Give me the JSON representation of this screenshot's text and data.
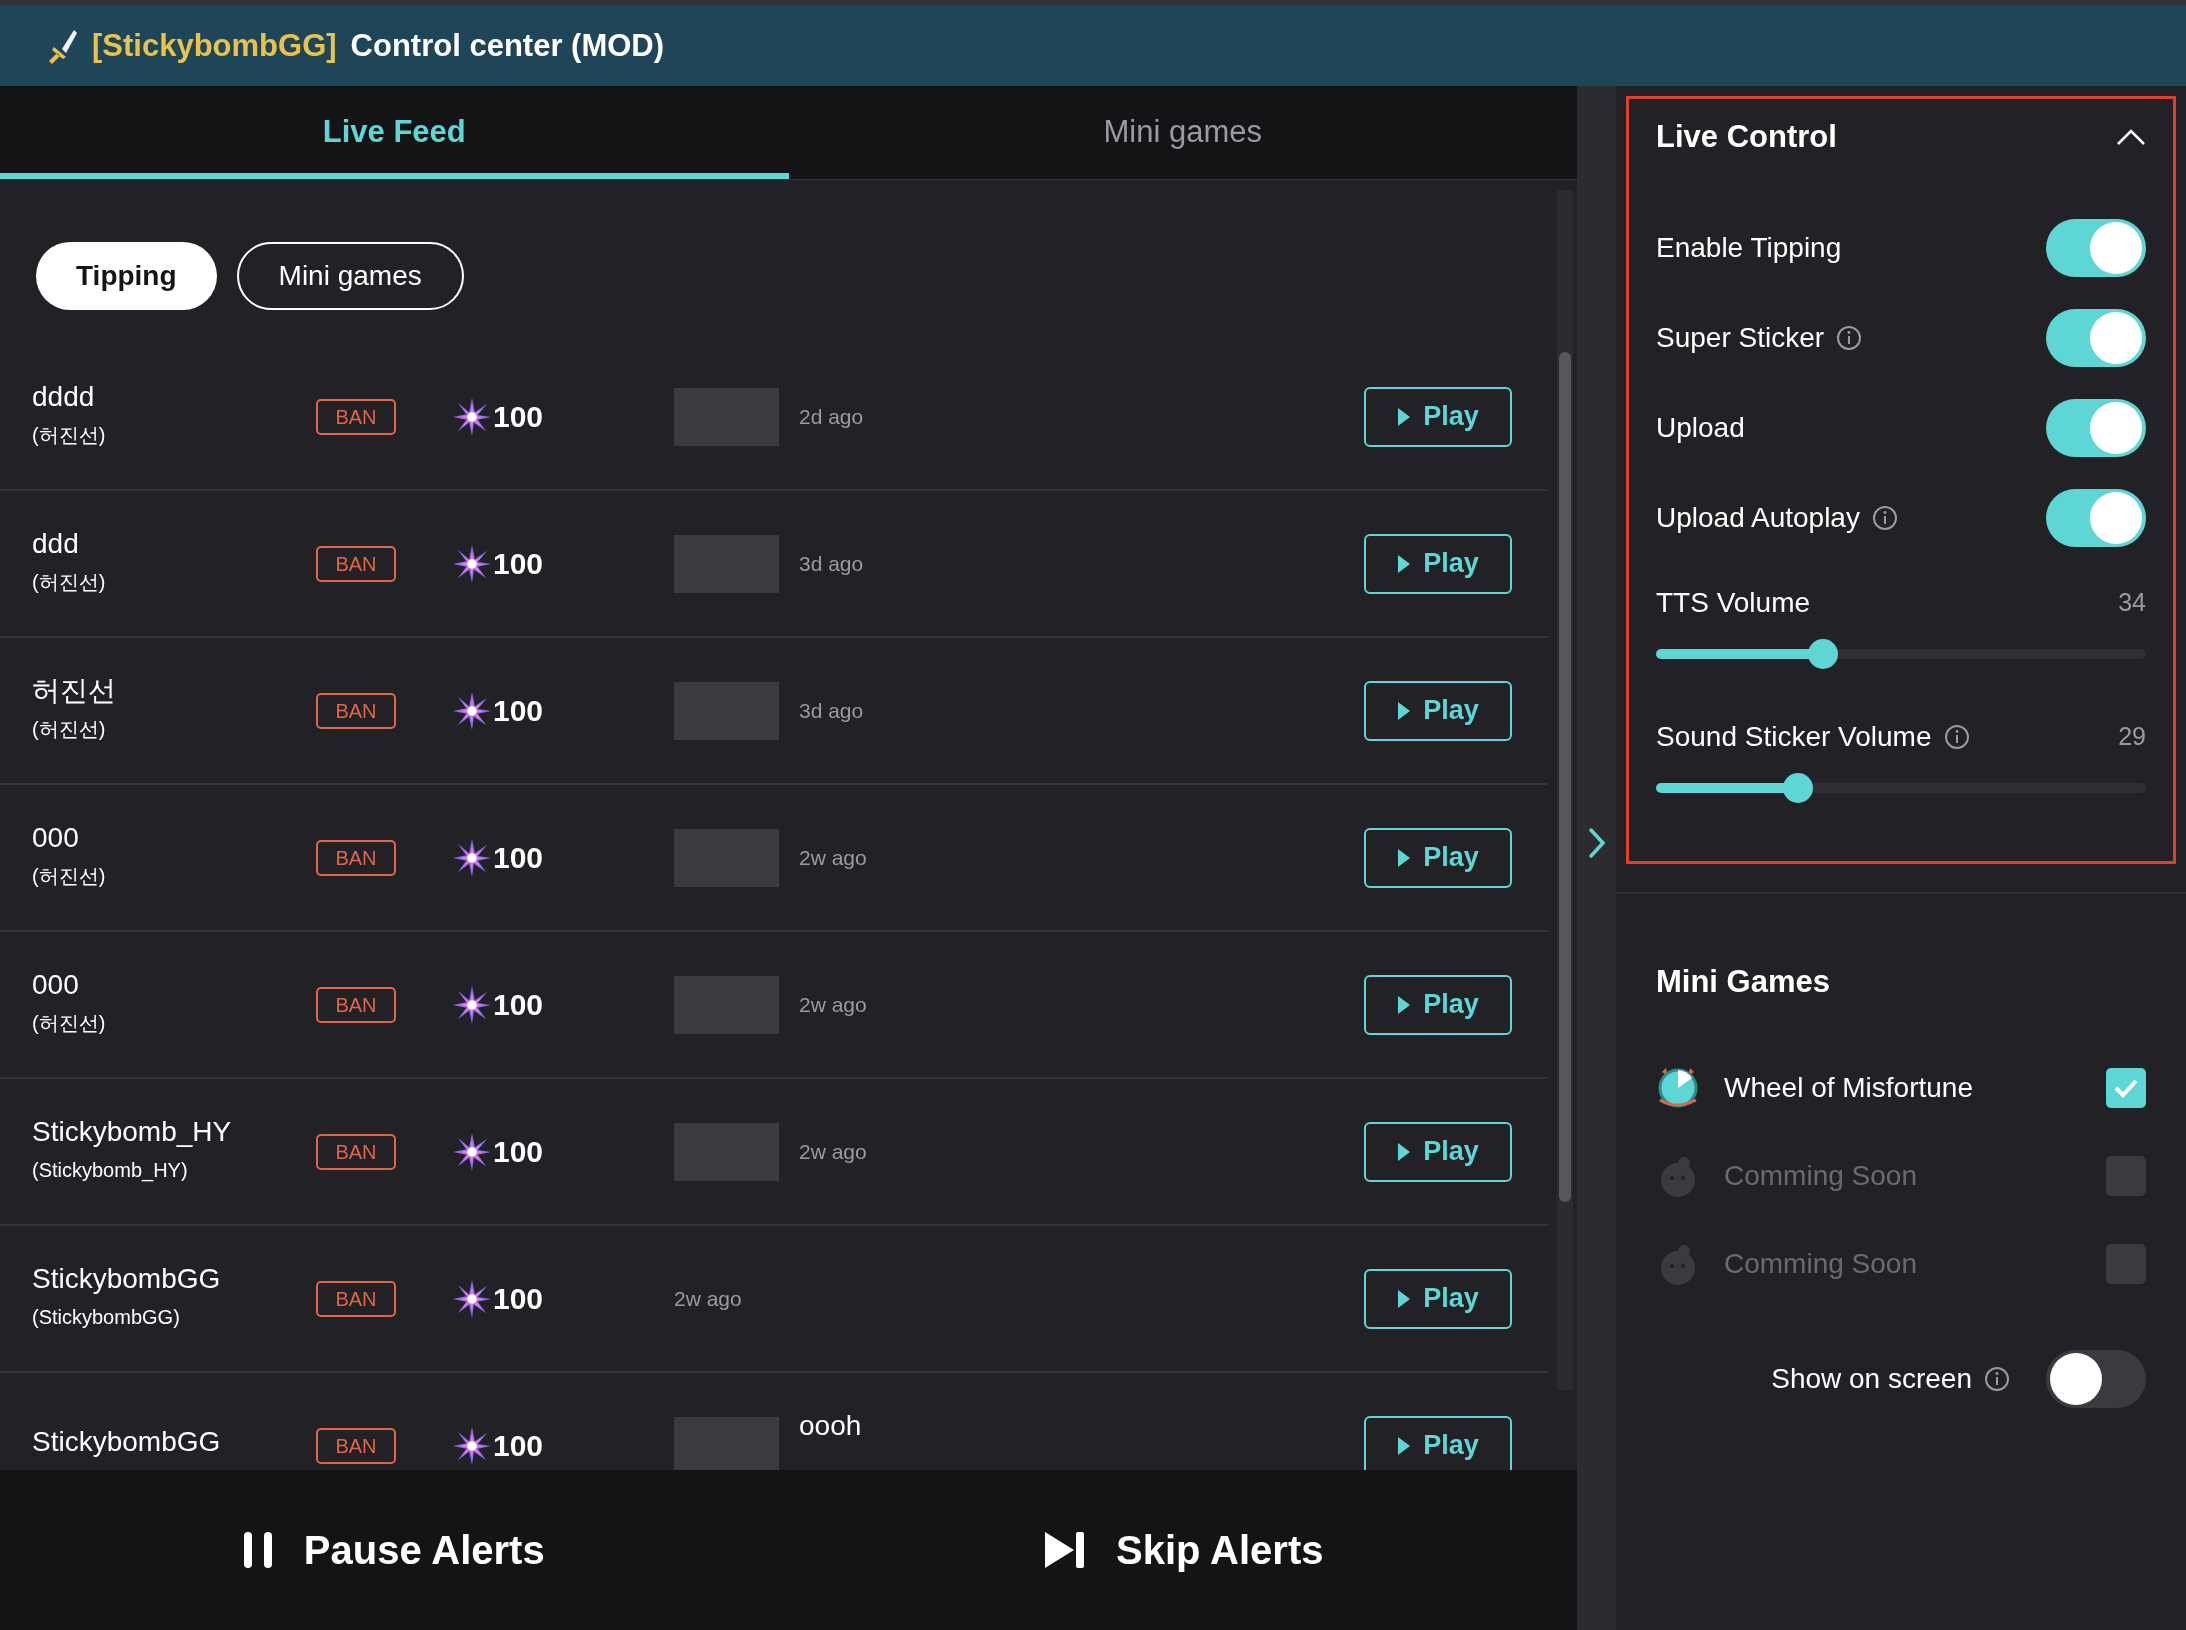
{
  "header": {
    "channel": "[StickybombGG]",
    "title": "Control center (MOD)"
  },
  "tabs": [
    {
      "label": "Live Feed",
      "selected": true
    },
    {
      "label": "Mini games",
      "selected": false
    }
  ],
  "filters": [
    {
      "label": "Tipping",
      "selected": true
    },
    {
      "label": "Mini games",
      "selected": false
    }
  ],
  "feed": [
    {
      "name": "dddd",
      "handle": "(허진선)",
      "ban": "BAN",
      "amount": "100",
      "thumbnail": true,
      "time": "2d ago",
      "play": "Play"
    },
    {
      "name": "ddd",
      "handle": "(허진선)",
      "ban": "BAN",
      "amount": "100",
      "thumbnail": true,
      "time": "3d ago",
      "play": "Play"
    },
    {
      "name": "허진선",
      "handle": "(허진선)",
      "ban": "BAN",
      "amount": "100",
      "thumbnail": true,
      "time": "3d ago",
      "play": "Play"
    },
    {
      "name": "000",
      "handle": "(허진선)",
      "ban": "BAN",
      "amount": "100",
      "thumbnail": true,
      "time": "2w ago",
      "play": "Play"
    },
    {
      "name": "000",
      "handle": "(허진선)",
      "ban": "BAN",
      "amount": "100",
      "thumbnail": true,
      "time": "2w ago",
      "play": "Play"
    },
    {
      "name": "Stickybomb_HY",
      "handle": "(Stickybomb_HY)",
      "ban": "BAN",
      "amount": "100",
      "thumbnail": true,
      "time": "2w ago",
      "play": "Play"
    },
    {
      "name": "StickybombGG",
      "handle": "(StickybombGG)",
      "ban": "BAN",
      "amount": "100",
      "thumbnail": false,
      "time": "2w ago",
      "play": "Play"
    },
    {
      "name": "StickybombGG",
      "ban": "BAN",
      "amount": "100",
      "thumbnail": true,
      "message": "oooh",
      "play": "Play"
    }
  ],
  "footer": [
    {
      "kind": "pause",
      "label": "Pause Alerts"
    },
    {
      "kind": "skip",
      "label": "Skip Alerts"
    }
  ],
  "live_control": {
    "title": "Live Control",
    "expanded": true,
    "highlighted": true,
    "settings": [
      {
        "kind": "toggle",
        "label": "Enable Tipping",
        "info": false,
        "on": true
      },
      {
        "kind": "toggle",
        "label": "Super Sticker",
        "info": true,
        "on": true
      },
      {
        "kind": "toggle",
        "label": "Upload",
        "info": false,
        "on": true
      },
      {
        "kind": "toggle",
        "label": "Upload Autoplay",
        "info": true,
        "on": true
      },
      {
        "kind": "slider",
        "label": "TTS Volume",
        "info": false,
        "reading": "34",
        "level": 0.34
      },
      {
        "kind": "slider",
        "label": "Sound Sticker Volume",
        "info": true,
        "reading": "29",
        "level": 0.29
      }
    ]
  },
  "mini_games": {
    "title": "Mini Games",
    "games": [
      {
        "name": "Wheel of Misfortune",
        "disabled": false,
        "checked": true
      },
      {
        "name": "Comming Soon",
        "disabled": true,
        "checked": false
      },
      {
        "name": "Comming Soon",
        "disabled": true,
        "checked": false
      }
    ],
    "show_on_screen": {
      "label": "Show on screen",
      "info": true,
      "on": false
    }
  }
}
